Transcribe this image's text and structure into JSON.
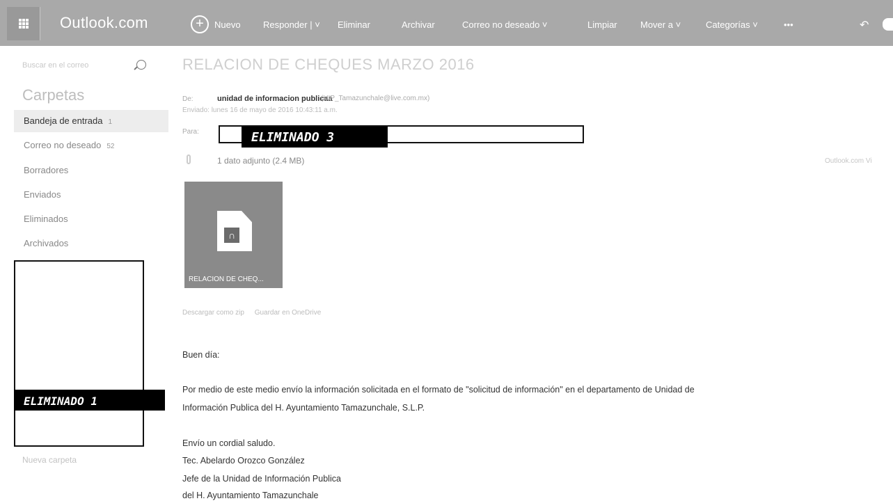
{
  "app": {
    "brand": "Outlook.com"
  },
  "toolbar": {
    "new_label": "Nuevo",
    "reply_label": "Responder | ˅",
    "delete_label": "Eliminar",
    "archive_label": "Archivar",
    "junk_label": "Correo no deseado ˅",
    "sweep_label": "Limpiar",
    "move_label": "Mover a ˅",
    "categories_label": "Categorías ˅",
    "more_label": "•••"
  },
  "search": {
    "placeholder": "Buscar en el correo"
  },
  "folders": {
    "title": "Carpetas",
    "items": [
      {
        "label": "Bandeja de entrada",
        "count": "1"
      },
      {
        "label": "Correo no deseado",
        "count": "52"
      },
      {
        "label": "Borradores",
        "count": ""
      },
      {
        "label": "Enviados",
        "count": ""
      },
      {
        "label": "Eliminados",
        "count": ""
      },
      {
        "label": "Archivados",
        "count": ""
      }
    ],
    "new_folder": "Nueva carpeta"
  },
  "redactions": {
    "sidebar_tag": "ELIMINADO   1",
    "to_tag": "ELIMINADO  3"
  },
  "message": {
    "subject": "RELACION DE CHEQUES MARZO 2016",
    "from_label": "De:",
    "from_name": "unidad de informacion publicaa",
    "from_address": "(UIP_Tamazunchale@live.com.mx)",
    "sent_label": "Enviado:",
    "sent_value": "lunes 16 de mayo de 2016 10:43:11 a.m.",
    "to_label": "Para:",
    "attachment_count": "1 dato adjunto (2.4 MB)",
    "outlook_link": "Outlook.com Vi",
    "attachment_name": "RELACION DE CHEQ...",
    "download_zip": "Descargar como zip",
    "save_onedrive": "Guardar en OneDrive",
    "body": {
      "greeting": "Buen día:",
      "line1": "Por medio de este medio envío la información solicitada en el formato de \"solicitud de información\" en el departamento de Unidad de",
      "line2": "Información Publica del H. Ayuntamiento Tamazunchale, S.L.P.",
      "closing": "Envío un cordial saludo.",
      "sig1": "Tec. Abelardo Orozco González",
      "sig2": "Jefe de la Unidad de Información Publica",
      "sig3": "del H. Ayuntamiento Tamazunchale"
    }
  }
}
